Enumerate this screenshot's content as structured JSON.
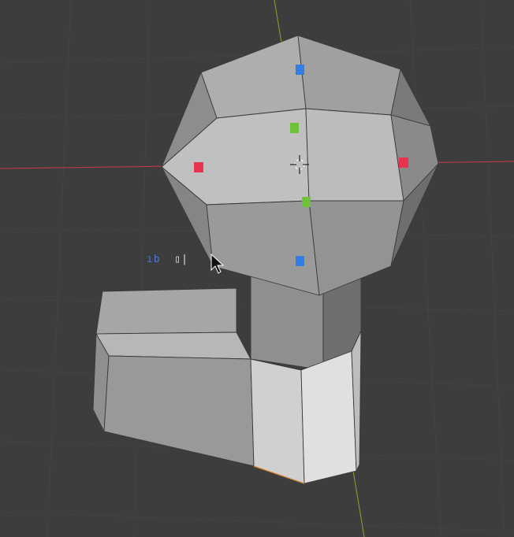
{
  "viewport": {
    "background": "#3d3d3d",
    "grid_color": "#434343",
    "x_axis_color": "#b23a48",
    "y_axis_color": "#8a9a2a",
    "mesh_light": "#bdbdbd",
    "mesh_mid": "#9a9a9a",
    "mesh_dark": "#7e7e7e",
    "edge_color": "#3a3a3a"
  },
  "gizmo": {
    "handle_colors": {
      "x": "#e8344c",
      "y": "#6fc13a",
      "z": "#2f7fe6"
    },
    "pivot_icon": "3d-cursor-crosshair-icon"
  },
  "cursor": {
    "icon": "mouse-pointer-arrow-icon",
    "input_prefix": "ıb",
    "input_text": "ıb ▯|",
    "input_caret": "|"
  }
}
